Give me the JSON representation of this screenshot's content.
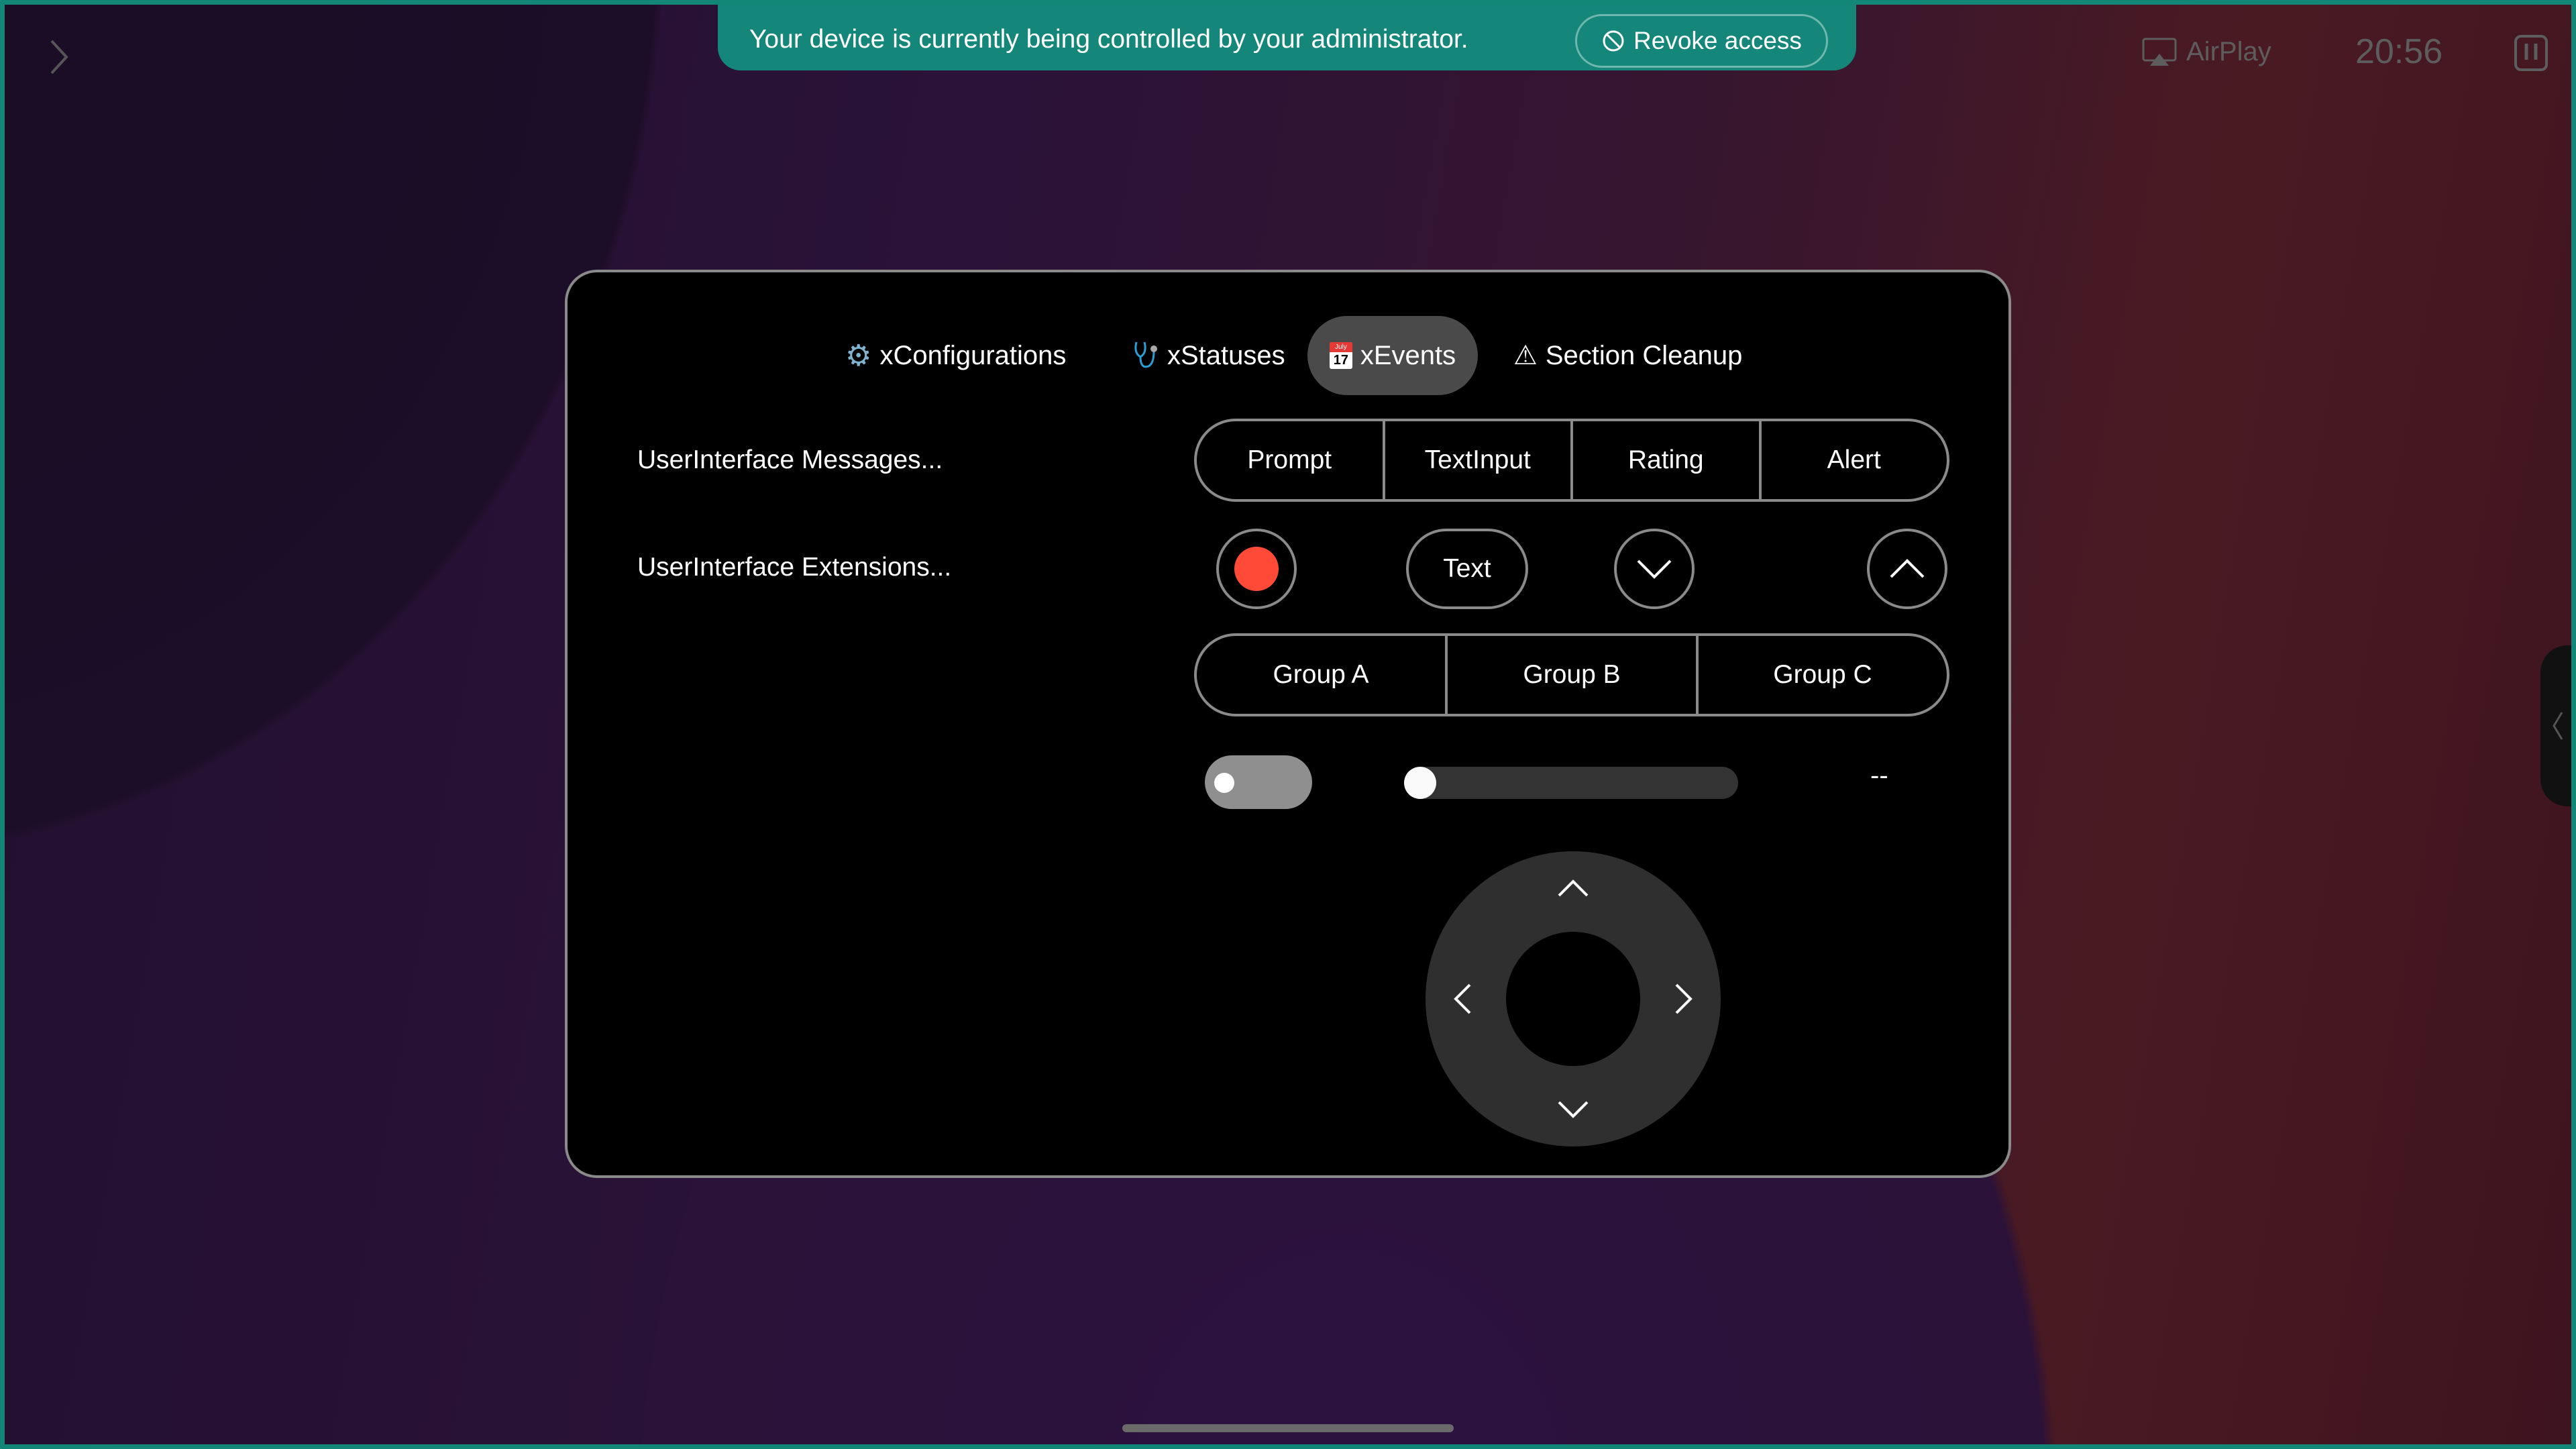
{
  "banner": {
    "message": "Your device is currently being controlled by your administrator.",
    "revoke_label": "Revoke access"
  },
  "status_bar": {
    "airplay_label": "AirPlay",
    "clock": "20:56"
  },
  "tabs": [
    {
      "label": "xConfigurations",
      "icon": "gear-icon",
      "active": false
    },
    {
      "label": "xStatuses",
      "icon": "stethoscope-icon",
      "active": false
    },
    {
      "label": "xEvents",
      "icon": "calendar-icon",
      "active": true
    },
    {
      "label": "Section Cleanup",
      "icon": "warning-icon",
      "active": false
    }
  ],
  "calendar_icon": {
    "month": "July",
    "day": "17"
  },
  "rows": {
    "messages_label": "UserInterface Messages...",
    "extensions_label": "UserInterface Extensions..."
  },
  "messages_buttons": [
    "Prompt",
    "TextInput",
    "Rating",
    "Alert"
  ],
  "extension_text_button": "Text",
  "groups": [
    "Group A",
    "Group B",
    "Group C"
  ],
  "toggle": {
    "on": false
  },
  "slider": {
    "value": 0
  },
  "slider_value_text": "--",
  "colors": {
    "banner": "#14877a",
    "record": "#ff4a38",
    "active_tab": "#4a4a4a"
  }
}
